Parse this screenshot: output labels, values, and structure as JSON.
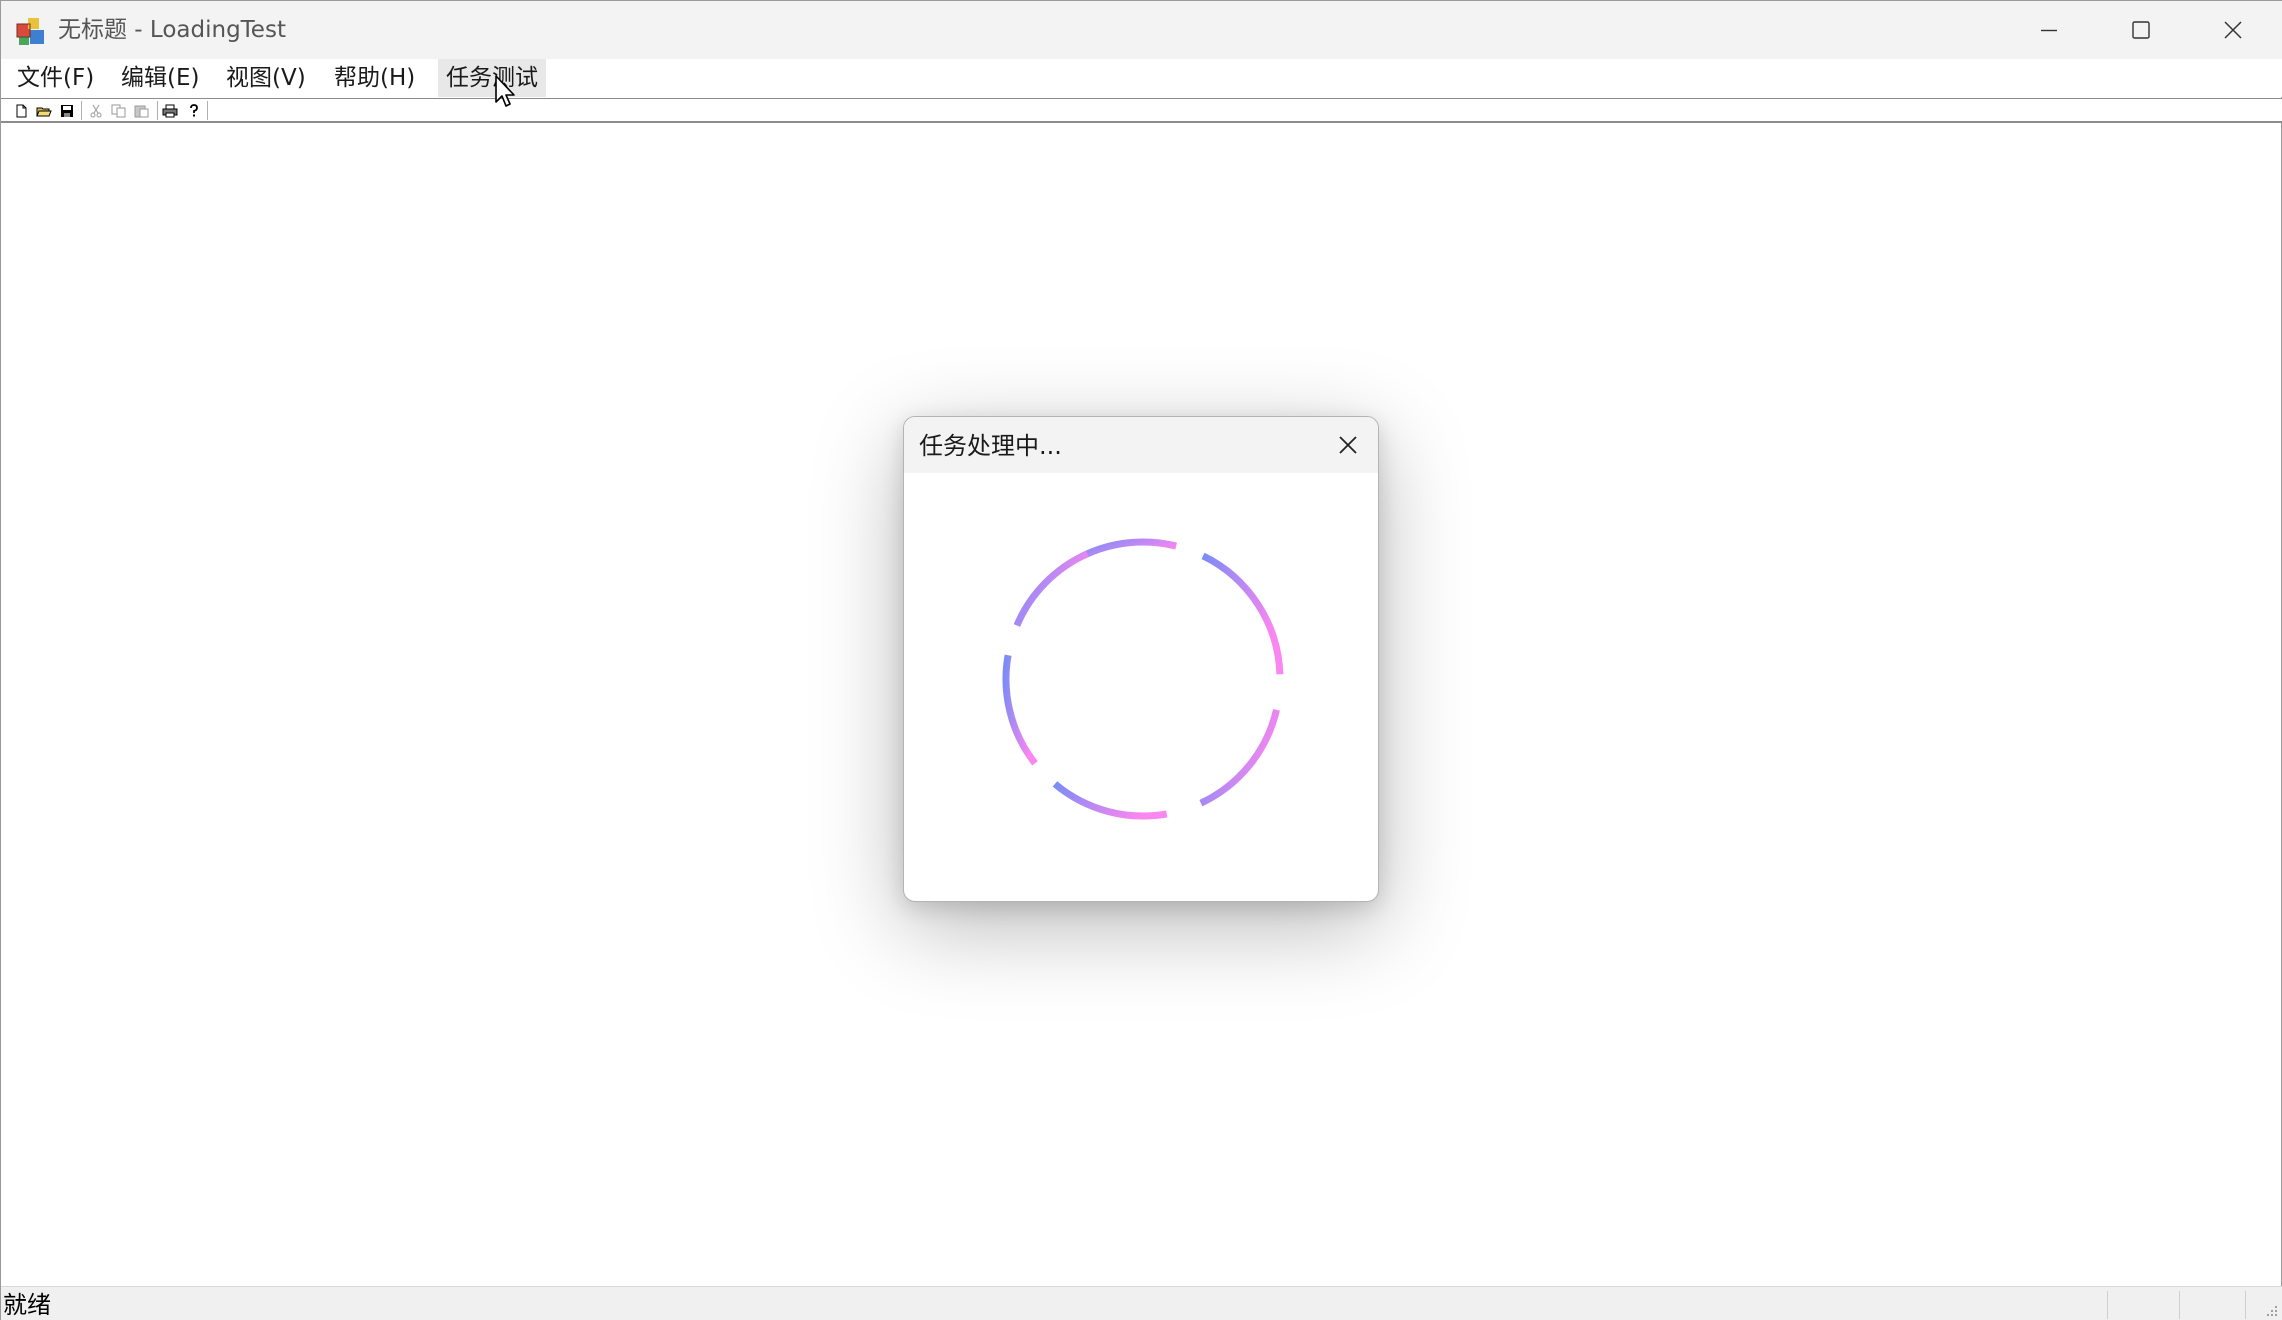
{
  "window": {
    "title": "无标题 - LoadingTest"
  },
  "menu": {
    "file": "文件(F)",
    "edit": "编辑(E)",
    "view": "视图(V)",
    "help": "帮助(H)",
    "task_test": "任务测试"
  },
  "toolbar": {
    "buttons": [
      "new-file-icon",
      "open-folder-icon",
      "save-icon",
      "cut-icon",
      "copy-icon",
      "paste-icon",
      "print-icon",
      "help-icon"
    ]
  },
  "dialog": {
    "title": "任务处理中...",
    "spinner": {
      "gradient_start": "#7b8cf5",
      "gradient_mid": "#b889f3",
      "gradient_end": "#f986f1"
    }
  },
  "status": {
    "text": "就绪"
  },
  "colors": {
    "titlebar": "#f3f3f3",
    "menu_hover": "#e8e8e8",
    "statusbar": "#f0f0f0"
  }
}
